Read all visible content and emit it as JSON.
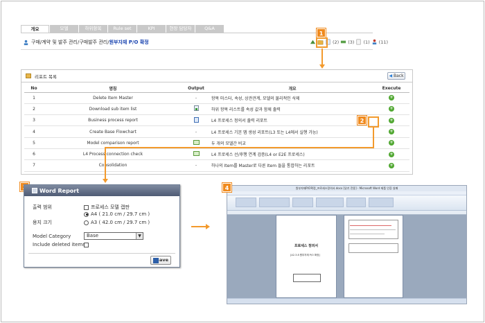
{
  "tabs": [
    "개요",
    "모델",
    "하위항목",
    "Rule set",
    "KPI",
    "현장 담당자",
    "Q&A"
  ],
  "breadcrumb": {
    "path": "구매/계약 및 발주 관리/구매발주 관리/",
    "current": "원부자재 P/O 확정"
  },
  "toolbar_counts": {
    "c1": "(2)",
    "c2": "(3)",
    "c3": "(1)",
    "c4": "(11)"
  },
  "callouts": {
    "step1": "1",
    "step2": "2",
    "step3": "3",
    "step4": "4"
  },
  "report_panel": {
    "title": "리포트 목록",
    "back_label": "Back",
    "columns": {
      "no": "No",
      "name": "명칭",
      "output": "Output",
      "desc": "개요",
      "execute": "Execute"
    },
    "rows": [
      {
        "no": "1",
        "name": "Delete Item Master",
        "output": "dash",
        "desc": "항목 마스터, 속성, 상관관계, 모델의 물리적인 삭제"
      },
      {
        "no": "2",
        "name": "Download sub item list",
        "output": "excel",
        "desc": "하위 항목 리스트를 속성 값과 함께 출력"
      },
      {
        "no": "3",
        "name": "Business process report",
        "output": "word",
        "desc": "L4 프로세스 정의서 출력 리포트"
      },
      {
        "no": "4",
        "name": "Create Base Flowchart",
        "output": "dash",
        "desc": "L4 프로세스 기본 맵 생성 리포트(L3 또는 L4에서 실행 가능)"
      },
      {
        "no": "5",
        "name": "Model comparison report",
        "output": "image",
        "desc": "두 개의 모델간 비교"
      },
      {
        "no": "6",
        "name": "L4 Process connection check",
        "output": "image",
        "desc": "L4 프로세스 선/후행 연계 검증(L4 or E2E 프로세스)"
      },
      {
        "no": "7",
        "name": "Consolidation",
        "output": "dash",
        "desc": "하나의 Item를 Master로 다른 Item 들을 통합하는 리포트"
      }
    ]
  },
  "word_report": {
    "title": "Word Report",
    "output_range_label": "출력 범위",
    "output_range_option": "프로세스 모델 캡판",
    "paper_size_label": "용지 크기",
    "paper_a4": "A4 ( 21.0 cm / 29.7 cm )",
    "paper_a3": "A3 ( 42.0 cm / 29.7 cm )",
    "model_category_label": "Model Category",
    "model_category_value": "Base",
    "include_deleted_label": "Include deleted items",
    "save_label": "Save"
  },
  "word_window": {
    "title_text": "원부자재P/O확정_프로세스정의서.docx [읽기 전용] - Microsoft Word 제품 인증 실패",
    "page1_title": "프로세스 정의서",
    "page1_subtitle": "[A2.3.8 원부자재 P/O 확정]"
  },
  "colors": {
    "accent": "#f39a2c",
    "execute": "#52a833",
    "link": "#1a44b0",
    "dialog_header": "#5a6680"
  }
}
